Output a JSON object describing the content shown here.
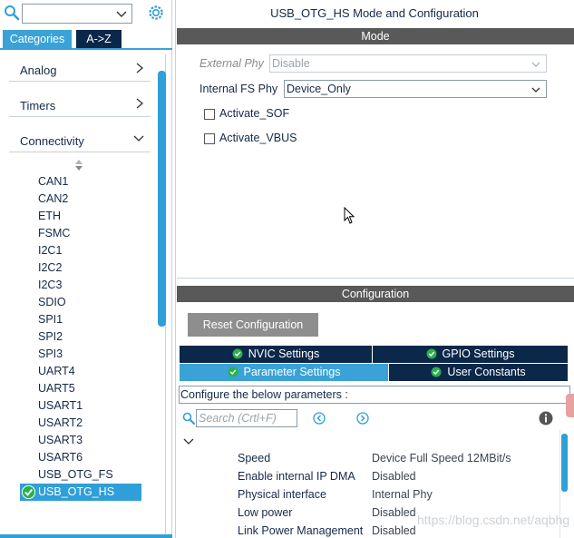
{
  "left_pane": {
    "search": {
      "value": ""
    },
    "tabs": {
      "categories": "Categories",
      "az": "A->Z"
    },
    "categories": [
      {
        "label": "Analog",
        "state": "collapsed"
      },
      {
        "label": "Timers",
        "state": "collapsed"
      },
      {
        "label": "Connectivity",
        "state": "expanded"
      }
    ],
    "peripherals": [
      "CAN1",
      "CAN2",
      "ETH",
      "FSMC",
      "I2C1",
      "I2C2",
      "I2C3",
      "SDIO",
      "SPI1",
      "SPI2",
      "SPI3",
      "UART4",
      "UART5",
      "USART1",
      "USART2",
      "USART3",
      "USART6",
      "USB_OTG_FS"
    ],
    "selected_peripheral": "USB_OTG_HS"
  },
  "right_pane": {
    "title": "USB_OTG_HS Mode and Configuration",
    "mode_header": "Mode",
    "mode": {
      "external_phy_label": "External Phy",
      "external_phy_value": "Disable",
      "internal_fs_phy_label": "Internal FS Phy",
      "internal_fs_phy_value": "Device_Only",
      "activate_sof_label": "Activate_SOF",
      "activate_vbus_label": "Activate_VBUS"
    },
    "configuration_header": "Configuration",
    "reset_button": "Reset Configuration",
    "tabs": {
      "nvic": "NVIC Settings",
      "gpio": "GPIO Settings",
      "parameter": "Parameter Settings",
      "user_constants": "User Constants"
    },
    "configure_text": "Configure the below parameters :",
    "param_search_placeholder": "Search (Crtl+F)",
    "parameters": [
      {
        "name": "Speed",
        "value": "Device Full Speed 12MBit/s"
      },
      {
        "name": "Enable internal IP DMA",
        "value": "Disabled"
      },
      {
        "name": "Physical interface",
        "value": "Internal Phy"
      },
      {
        "name": "Low power",
        "value": "Disabled"
      },
      {
        "name": "Link Power Management",
        "value": "Disabled"
      }
    ],
    "watermark": "https://blog.csdn.net/aqbhg"
  },
  "colors": {
    "accent": "#3aa2d6",
    "dark_navy": "#0b2749",
    "section_header": "#595959",
    "button_gray": "#8e8e8e"
  }
}
